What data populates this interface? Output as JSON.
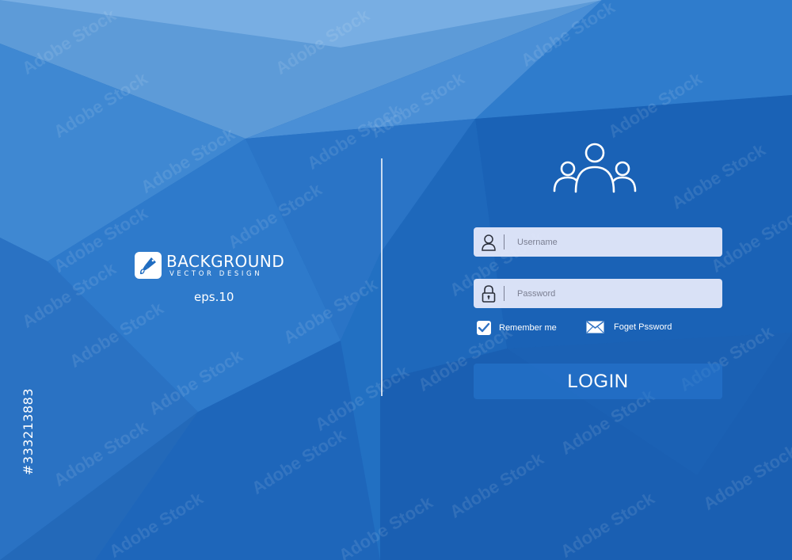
{
  "brand": {
    "title": "BACKGROUND",
    "subtitle": "VECTOR DESIGN",
    "version": "eps.10"
  },
  "stock_id": "#333213883",
  "watermark_text": "Adobe Stock",
  "login": {
    "username_placeholder": "Username",
    "password_placeholder": "Password",
    "remember_label": "Remember me",
    "forgot_label": "Foget Pssword",
    "button_label": "LOGIN"
  },
  "colors": {
    "background": "#1f6cc0",
    "field_background": "#e4e8fa",
    "text": "#ffffff"
  }
}
